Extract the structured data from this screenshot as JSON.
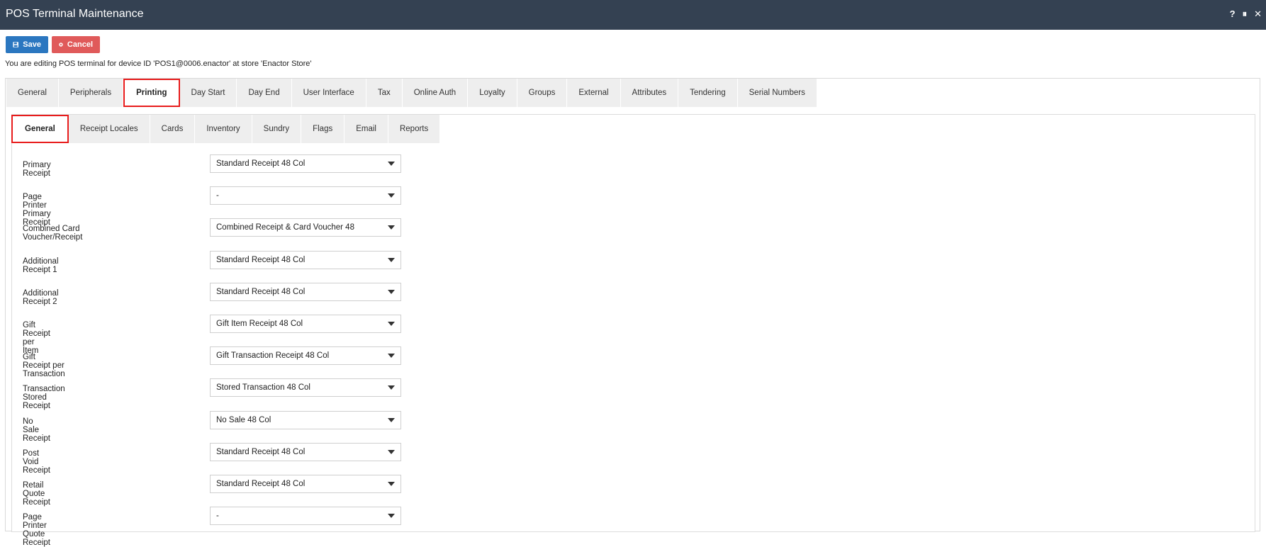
{
  "window": {
    "title": "POS Terminal Maintenance",
    "controls": [
      "?",
      "⏸",
      "✕"
    ]
  },
  "toolbar": {
    "save_label": "Save",
    "cancel_label": "Cancel"
  },
  "info_text": "You are editing POS terminal for device ID 'POS1@0006.enactor' at store 'Enactor Store'",
  "main_tabs": [
    {
      "label": "General"
    },
    {
      "label": "Peripherals"
    },
    {
      "label": "Printing"
    },
    {
      "label": "Day Start"
    },
    {
      "label": "Day End"
    },
    {
      "label": "User Interface"
    },
    {
      "label": "Tax"
    },
    {
      "label": "Online Auth"
    },
    {
      "label": "Loyalty"
    },
    {
      "label": "Groups"
    },
    {
      "label": "External"
    },
    {
      "label": "Attributes"
    },
    {
      "label": "Tendering"
    },
    {
      "label": "Serial Numbers"
    }
  ],
  "sub_tabs": [
    {
      "label": "General"
    },
    {
      "label": "Receipt Locales"
    },
    {
      "label": "Cards"
    },
    {
      "label": "Inventory"
    },
    {
      "label": "Sundry"
    },
    {
      "label": "Flags"
    },
    {
      "label": "Email"
    },
    {
      "label": "Reports"
    }
  ],
  "fields": [
    {
      "label": "Primary Receipt",
      "value": "Standard Receipt 48 Col"
    },
    {
      "label": "Page Printer Primary Receipt",
      "value": "-"
    },
    {
      "label": "Combined Card Voucher/Receipt",
      "value": "Combined Receipt & Card Voucher 48"
    },
    {
      "label": "Additional Receipt 1",
      "value": "Standard Receipt 48 Col"
    },
    {
      "label": "Additional Receipt 2",
      "value": "Standard Receipt 48 Col"
    },
    {
      "label": "Gift Receipt per Item",
      "value": "Gift Item Receipt 48 Col"
    },
    {
      "label": "Gift Receipt per Transaction",
      "value": "Gift Transaction Receipt 48 Col"
    },
    {
      "label": "Transaction Stored Receipt",
      "value": "Stored Transaction 48 Col"
    },
    {
      "label": "No Sale Receipt",
      "value": "No Sale 48 Col"
    },
    {
      "label": "Post Void Receipt",
      "value": "Standard Receipt 48 Col"
    },
    {
      "label": "Retail Quote Receipt",
      "value": "Standard Receipt 48 Col"
    },
    {
      "label": "Page Printer Quote Receipt",
      "value": "-"
    }
  ],
  "colors": {
    "titlebar": "#344152",
    "save": "#2b77c0",
    "cancel": "#e05a5a",
    "highlight": "#e81c1c"
  }
}
